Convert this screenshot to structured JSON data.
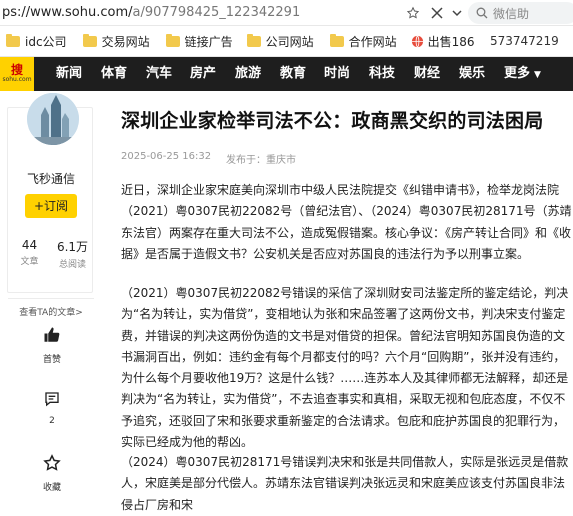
{
  "browser": {
    "url_host": "ps://www.sohu.com/",
    "url_path": "a/907798425_122342291",
    "search_placeholder": "微信助"
  },
  "bookmarks": {
    "items": [
      "idc公司",
      "交易网站",
      "链接广告",
      "公司网站",
      "合作网站",
      "出售186"
    ],
    "number": "573747219"
  },
  "nav": {
    "logo_top": "搜",
    "logo_bottom": "sohu.com",
    "tabs": [
      "新闻",
      "体育",
      "汽车",
      "房产",
      "旅游",
      "教育",
      "时尚",
      "科技",
      "财经",
      "娱乐"
    ],
    "more": "更多"
  },
  "author": {
    "name": "飞秒通信",
    "follow": "+订阅",
    "articles_count": "44",
    "articles_label": "文章",
    "views_count": "6.1万",
    "views_label": "总阅读",
    "more_link": "查看TA的文章>"
  },
  "actions": {
    "like_label": "首赞",
    "comment_count": "2",
    "collect_label": "收藏"
  },
  "article": {
    "title": "深圳企业家检举司法不公：政商黑交织的司法困局",
    "date": "2025-06-25 16:32",
    "location": "发布于：重庆市",
    "paragraphs": [
      "近日，深圳企业家宋庭美向深圳市中级人民法院提交《纠错申请书》，检举龙岗法院（2021）粤0307民初22082号（曾纪法官）、（2024）粤0307民初28171号（苏靖东法官）两案存在重大司法不公，造成冤假错案。核心争议：《房产转让合同》和《收据》是否属于造假文书？公安机关是否应对苏国良的违法行为予以刑事立案。",
      "（2021）粤0307民初22082号错误的采信了深圳财安司法鉴定所的鉴定结论，判决为“名为转让，实为借贷”，变相地认为张和宋品签署了这两份文书，判决宋支付鉴定费，并错误的判决这两份伪造的文书是对借贷的担保。曾纪法官明知苏国良伪造的文书漏洞百出，例如：违约金有每个月都支付的吗？六个月“回购期”，张并没有违约，为什么每个月要收他19万？这是什么钱？……连苏本人及其律师都无法解释，却还是判决为“名为转让，实为借贷”，不去追查事实和真相，采取无视和包庇态度，不仅不予追究，还驳回了宋和张要求重新鉴定的合法请求。包庇和庇护苏国良的犯罪行为，实际已经成为他的帮凶。",
      "（2024）粤0307民初28171号错误判决宋和张是共同借款人，实际是张远灵是借款人，宋庭美是部分代偿人。苏靖东法官错误判决张远灵和宋庭美应该支付苏国良非法侵占厂房和宋"
    ]
  }
}
